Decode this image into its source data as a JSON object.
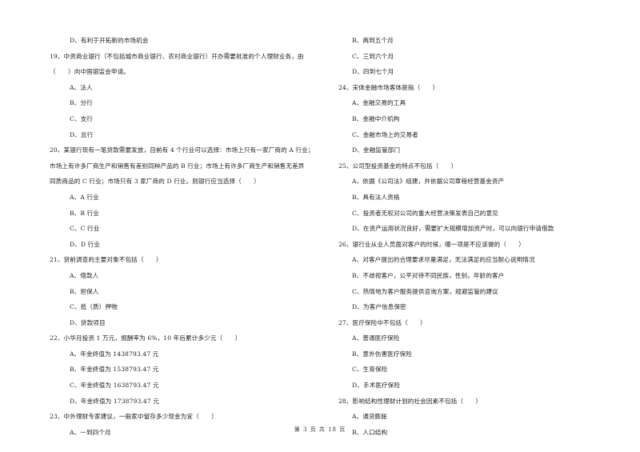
{
  "left_column": [
    {
      "type": "opt",
      "text": "D、有利于开拓新的市场机会"
    },
    {
      "type": "q",
      "text": "19、中资商业银行（不包括城市商业银行、农村商业银行）开办需要批准的个人理财业务，由"
    },
    {
      "type": "cont",
      "text": "（　　）向中国银监会申请。"
    },
    {
      "type": "opt",
      "text": "A、法人"
    },
    {
      "type": "opt",
      "text": "B、分行"
    },
    {
      "type": "opt",
      "text": "C、支行"
    },
    {
      "type": "opt",
      "text": "D、总行"
    },
    {
      "type": "q",
      "text": "20、某银行现有一笔贷款需要发放，目前有 4 个行业可以选择：市场上只有一家厂商的 A 行业；"
    },
    {
      "type": "cont",
      "text": "市场上有许多厂商生产和销售有差别同种产品的 B 行业；市场上有许多厂商生产和销售无差异"
    },
    {
      "type": "cont",
      "text": "同质商品的 C 行业；市场只有 3 家厂商的 D 行业。则银行应当选择（　　）"
    },
    {
      "type": "opt",
      "text": "A、A 行业"
    },
    {
      "type": "opt",
      "text": "B、B 行业"
    },
    {
      "type": "opt",
      "text": "C、C 行业"
    },
    {
      "type": "opt",
      "text": "D、D 行业"
    },
    {
      "type": "q",
      "text": "21、贷前调查的主要对象不包括（　　）"
    },
    {
      "type": "opt",
      "text": "A、借款人"
    },
    {
      "type": "opt",
      "text": "B、担保人"
    },
    {
      "type": "opt",
      "text": "C、抵（质）押物"
    },
    {
      "type": "opt",
      "text": "D、贷款项目"
    },
    {
      "type": "q",
      "text": "22、小华月投资 1 万元，报酬率为 6%，10 年后累计多少元（　　）"
    },
    {
      "type": "opt",
      "text": "A、年金终值为 1438793.47 元"
    },
    {
      "type": "opt",
      "text": "B、年金终值为 1538793.47 元"
    },
    {
      "type": "opt",
      "text": "C、年金终值为 1638793.47 元"
    },
    {
      "type": "opt",
      "text": "D、年金终值为 1738793.47 元"
    },
    {
      "type": "q",
      "text": "23、中外理财专家建议，一般家中留存多少现金为宜（　　）"
    },
    {
      "type": "opt",
      "text": "A、一到四个月"
    }
  ],
  "right_column": [
    {
      "type": "opt",
      "text": "B、两到五个月"
    },
    {
      "type": "opt",
      "text": "C、三到六个月"
    },
    {
      "type": "opt",
      "text": "D、四到七个月"
    },
    {
      "type": "q",
      "text": "24、宋体金融市场客体是指（　　）"
    },
    {
      "type": "opt",
      "text": "A、金融交易的工具"
    },
    {
      "type": "opt",
      "text": "B、金融中介机构"
    },
    {
      "type": "opt",
      "text": "C、金融市场上的交易者"
    },
    {
      "type": "opt",
      "text": "D、金融监管部门"
    },
    {
      "type": "q",
      "text": "25、公司型投资基金的特点不包括（　　）"
    },
    {
      "type": "opt",
      "text": "A、依据《公司法》组建，并依据公司章程经营基金资产"
    },
    {
      "type": "opt",
      "text": "B、具有法人资格"
    },
    {
      "type": "opt",
      "text": "C、投资者无权对公司的重大经营决策发表自己的意见"
    },
    {
      "type": "opt",
      "text": "D、在资产运用状况良好，需要扩大规模增加资产时，可以向银行申请借款"
    },
    {
      "type": "q",
      "text": "26、银行业从业人员面对客户的时候，哪一项是不应该做的（　　）"
    },
    {
      "type": "opt",
      "text": "A、对客户提出的合理要求尽量满足，无法满足的应当耐心说明情况"
    },
    {
      "type": "opt",
      "text": "B、不歧视客户，公平对待不同民族，性别，年龄的客户"
    },
    {
      "type": "opt",
      "text": "C、热情地为客户服务提供咨询方案，规避监管的建议"
    },
    {
      "type": "opt",
      "text": "D、为客户信息保密"
    },
    {
      "type": "q",
      "text": "27、医疗保险中不包括（　　）"
    },
    {
      "type": "opt",
      "text": "A、普通医疗保险"
    },
    {
      "type": "opt",
      "text": "B、意外伤害医疗保险"
    },
    {
      "type": "opt",
      "text": "C、生育保险"
    },
    {
      "type": "opt",
      "text": "D、手术医疗保险"
    },
    {
      "type": "q",
      "text": "28、影响结构性理财计划的社会因素不包括（　　）"
    },
    {
      "type": "opt",
      "text": "A、通货膨胀"
    },
    {
      "type": "opt",
      "text": "B、人口结构"
    }
  ],
  "footer": {
    "page_label": "第 3 页 共 18 页"
  }
}
